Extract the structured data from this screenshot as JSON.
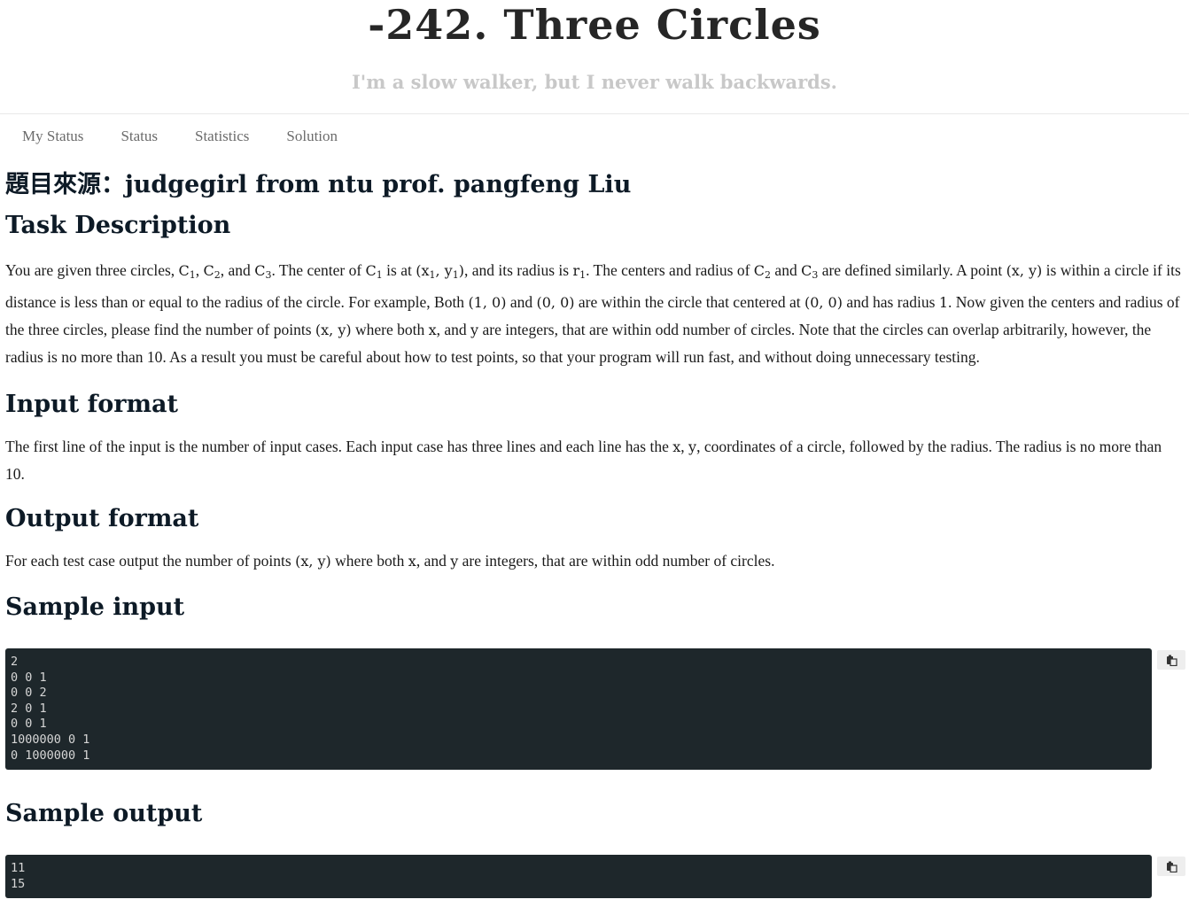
{
  "header": {
    "title": "-242. Three Circles",
    "subtitle": "I'm a slow walker, but I never walk backwards."
  },
  "nav": {
    "items": [
      "My Status",
      "Status",
      "Statistics",
      "Solution"
    ]
  },
  "problem": {
    "source": "題目來源：judgegirl from ntu prof. pangfeng Liu",
    "task_heading": "Task Description",
    "task": {
      "t1": "You are given three circles, ",
      "c1": "C",
      "c1_sub": "1",
      "comma1": ", ",
      "c2": "C",
      "c2_sub": "2",
      "t2": ", and ",
      "c3": "C",
      "c3_sub": "3",
      "t3": ". The center of ",
      "c1b": "C",
      "c1b_sub": "1",
      "t4": " is at ",
      "xy1_open": "(x",
      "xy1_x_sub": "1",
      "xy1_mid": ", y",
      "xy1_y_sub": "1",
      "xy1_close": ")",
      "t5": ", and its radius is ",
      "r1": "r",
      "r1_sub": "1",
      "t6": ". The centers and radius of ",
      "c2b": "C",
      "c2b_sub": "2",
      "t7": " and ",
      "c3b": "C",
      "c3b_sub": "3",
      "t8": " are defined similarly. A point ",
      "pt": "(x, y)",
      "t9": " is within a circle if its distance is less than or equal to the radius of the circle. For example, Both ",
      "p10": "(1, 0)",
      "t10": " and ",
      "p00": "(0, 0)",
      "t11": " are within the circle that centered at ",
      "p00b": "(0, 0)",
      "t12": " and has radius ",
      "one": "1",
      "t13": ". Now given the centers and radius of the three circles, please find the number of points ",
      "pt2": "(x, y)",
      "t14": " where both ",
      "x1": "x",
      "t15": ", and ",
      "y1": "y",
      "t16": " are integers, that are within odd number of circles. Note that the circles can overlap arbitrarily, however, the radius is no more than 10. As a result you must be careful about how to test points, so that your program will run fast, and without doing unnecessary testing."
    },
    "input_heading": "Input format",
    "input": {
      "t1": "The first line of the input is the number of input cases. Each input case has three lines and each line has the ",
      "x": "x",
      "comma": ", ",
      "y": "y",
      "t2": ", coordinates of a circle, followed by the radius. The radius is no more than 10."
    },
    "output_heading": "Output format",
    "output": {
      "t1": "For each test case output the number of points ",
      "pt": "(x, y)",
      "t2": " where both ",
      "x": "x",
      "t3": ", and ",
      "y": "y",
      "t4": " are integers, that are within odd number of circles."
    },
    "sample_input_heading": "Sample input",
    "sample_input": "2\n0 0 1\n0 0 2\n2 0 1\n0 0 1\n1000000 0 1\n0 1000000 1",
    "sample_output_heading": "Sample output",
    "sample_output": "11\n15"
  },
  "icons": {
    "copy": "clipboard-icon"
  }
}
